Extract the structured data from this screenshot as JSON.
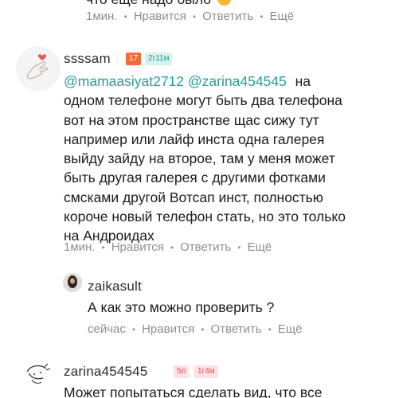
{
  "top_comment": {
    "text_fragment": "что еще надо было",
    "time": "1мин.",
    "like": "Нравится",
    "reply": "Ответить",
    "more": "Ещё"
  },
  "comment_ssssam": {
    "username": "ssssam",
    "badge_level": "17",
    "badge_age": "2г11м",
    "mention_1": "@mamaasiyat2712",
    "mention_2": "@zarina454545",
    "text_line_1": "на",
    "lines": [
      "одном телефоне могут быть два телефона",
      "вот на этом пространстве щас сижу тут",
      "например или лайф инста одна галерея",
      "выйду зайду на второе, там у меня может",
      "быть другая галерея с другими фотками",
      "смсками другой Вотсап инст, полностью",
      "короче новый телефон стать, но это только",
      "на Андроидах"
    ],
    "time": "1мин.",
    "like": "Нравится",
    "reply": "Ответить",
    "more": "Ещё"
  },
  "reply_zaikasult": {
    "username": "zaikasult",
    "text": "А как это можно проверить ?",
    "time": "сейчас",
    "like": "Нравится",
    "reply": "Ответить",
    "more": "Ещё"
  },
  "comment_zarina": {
    "username": "zarina454545",
    "badge_level": "5л",
    "badge_age": "1г4м",
    "text": "Может попытаться сделать вид, что все"
  },
  "colors": {
    "mention": "#2a9d9a",
    "badge_orange": "#f26b3a",
    "badge_teal_bg": "#d7f1ef",
    "badge_pink_bg": "#fde2e4",
    "meta_gray": "#8e8e93",
    "emoji": "#f5b731"
  }
}
